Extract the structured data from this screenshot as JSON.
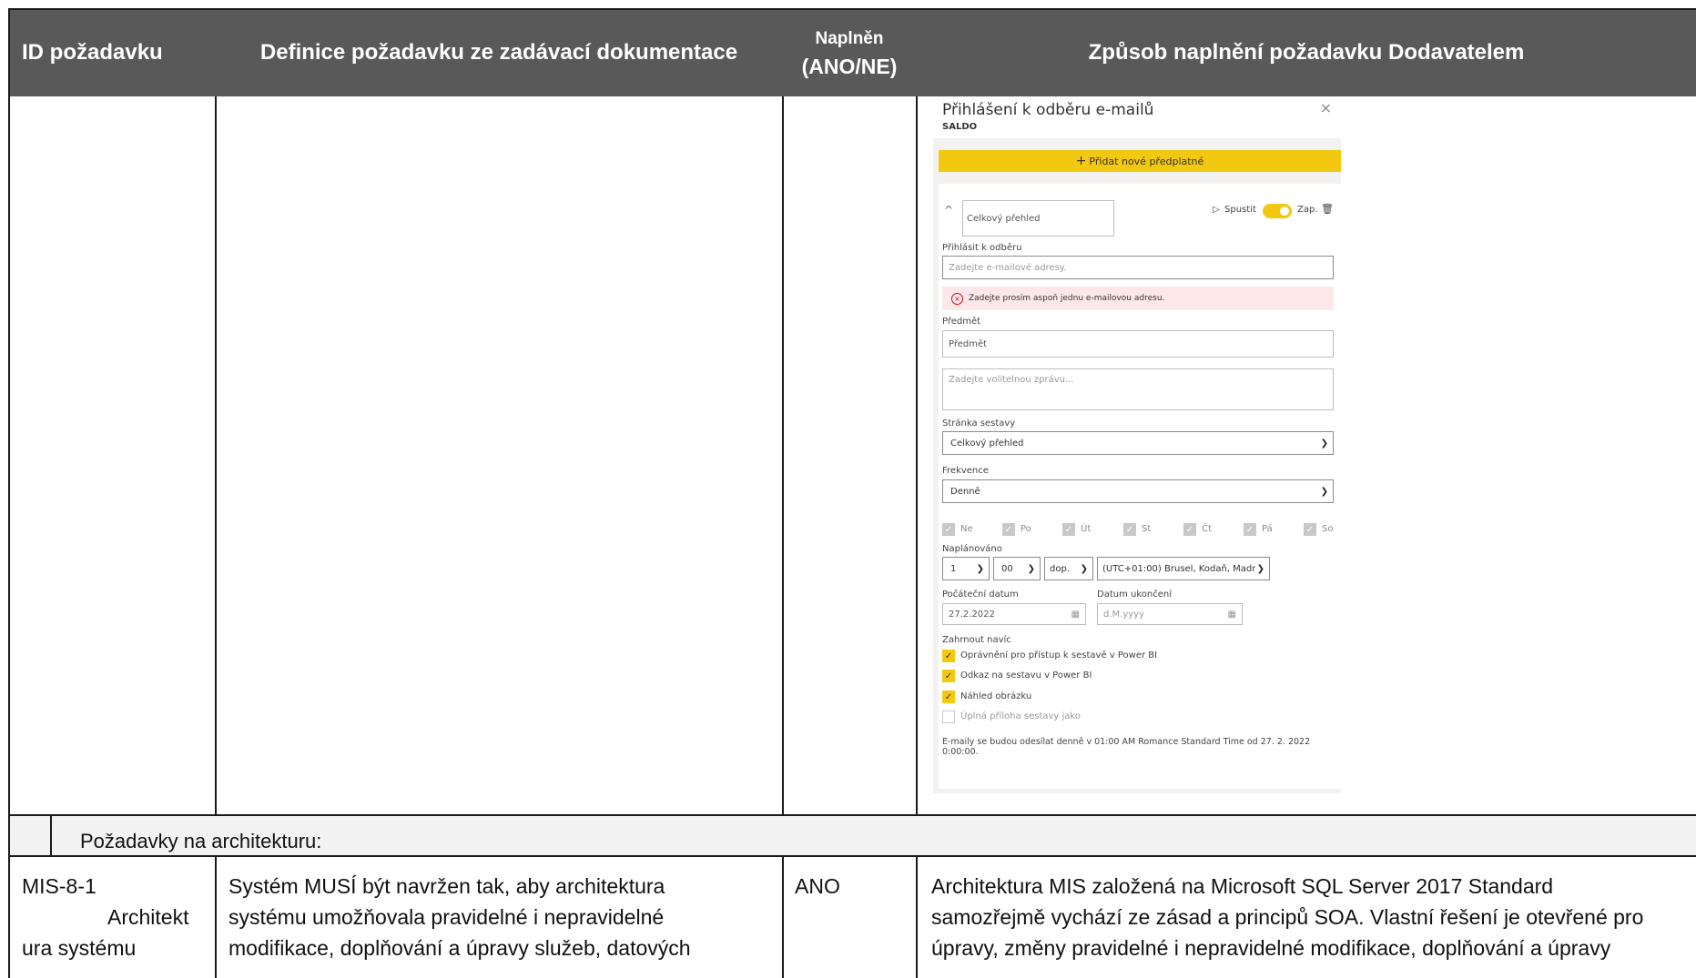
{
  "header": {
    "col1": "ID požadavku",
    "col2": "Definice požadavku ze zadávací dokumentace",
    "col3_line1": "Naplněn",
    "col3_line2": "(ANO/NE)",
    "col4": "Způsob naplnění požadavku Dodavatelem"
  },
  "subscription_dialog": {
    "title": "Přihlášení k odběru e-mailů",
    "subtitle": "SALDO",
    "close_glyph": "×",
    "add_button": "Přidat nové předplatné",
    "add_button_icon": "+",
    "collapse_glyph": "^",
    "subscription_name": "Celkový přehled",
    "run_label": "Spustit",
    "run_glyph": "▷",
    "toggle_label": "Zap.",
    "subscribe_label": "Přihlásit k odběru",
    "email_placeholder": "Zadejte e-mailové adresy.",
    "error_message": "Zadejte prosím aspoň jednu e-mailovou adresu.",
    "subject_label": "Předmět",
    "subject_value": "Předmět",
    "message_placeholder": "Zadejte volitelnou zprávu...",
    "report_page_label": "Stránka sestavy",
    "report_page_value": "Celkový přehled",
    "frequency_label": "Frekvence",
    "frequency_value": "Denně",
    "days": [
      "Ne",
      "Po",
      "Út",
      "St",
      "Čt",
      "Pá",
      "So"
    ],
    "scheduled_label": "Naplánováno",
    "hour_value": "1",
    "minute_value": "00",
    "ampm_value": "dop.",
    "timezone_value": "(UTC+01:00) Brusel, Kodaň, Madr",
    "start_date_label": "Počáteční datum",
    "start_date_value": "27.2.2022",
    "end_date_label": "Datum ukončení",
    "end_date_placeholder": "d.M.yyyy",
    "include_label": "Zahrnout navíc",
    "include_options": [
      {
        "label": "Oprávnění pro přístup k sestavě v Power BI",
        "checked": true
      },
      {
        "label": "Odkaz na sestavu v Power BI",
        "checked": true
      },
      {
        "label": "Náhled obrázku",
        "checked": true
      },
      {
        "label": "Úplná příloha sestavy jako",
        "checked": false
      }
    ],
    "footer_line1": "E-maily se budou odesílat denně v 01:00 AM Romance Standard Time od 27. 2. 2022",
    "footer_line2": "0:00:00.",
    "accent_color": "#f2c811"
  },
  "section": {
    "title": "Požadavky na architekturu:"
  },
  "row": {
    "id_line1": "MIS-8-1",
    "id_line2": "Architekt",
    "id_line3": "ura systému",
    "definition_line1": "Systém MUSÍ být navržen tak, aby architektura",
    "definition_line2": "systému umožňovala pravidelné i nepravidelné",
    "definition_line3": "modifikace, doplňování a úpravy služeb, datových",
    "fulfilled": "ANO",
    "method_line1": "Architektura MIS založená na Microsoft SQL Server 2017 Standard",
    "method_line2": "samozřejmě vychází ze zásad a principů SOA. Vlastní řešení je otevřené pro",
    "method_line3": "úpravy, změny pravidelné i nepravidelné modifikace, doplňování a úpravy"
  },
  "colors": {
    "header_bg": "#595959",
    "section_bg": "#f2f2f2"
  }
}
